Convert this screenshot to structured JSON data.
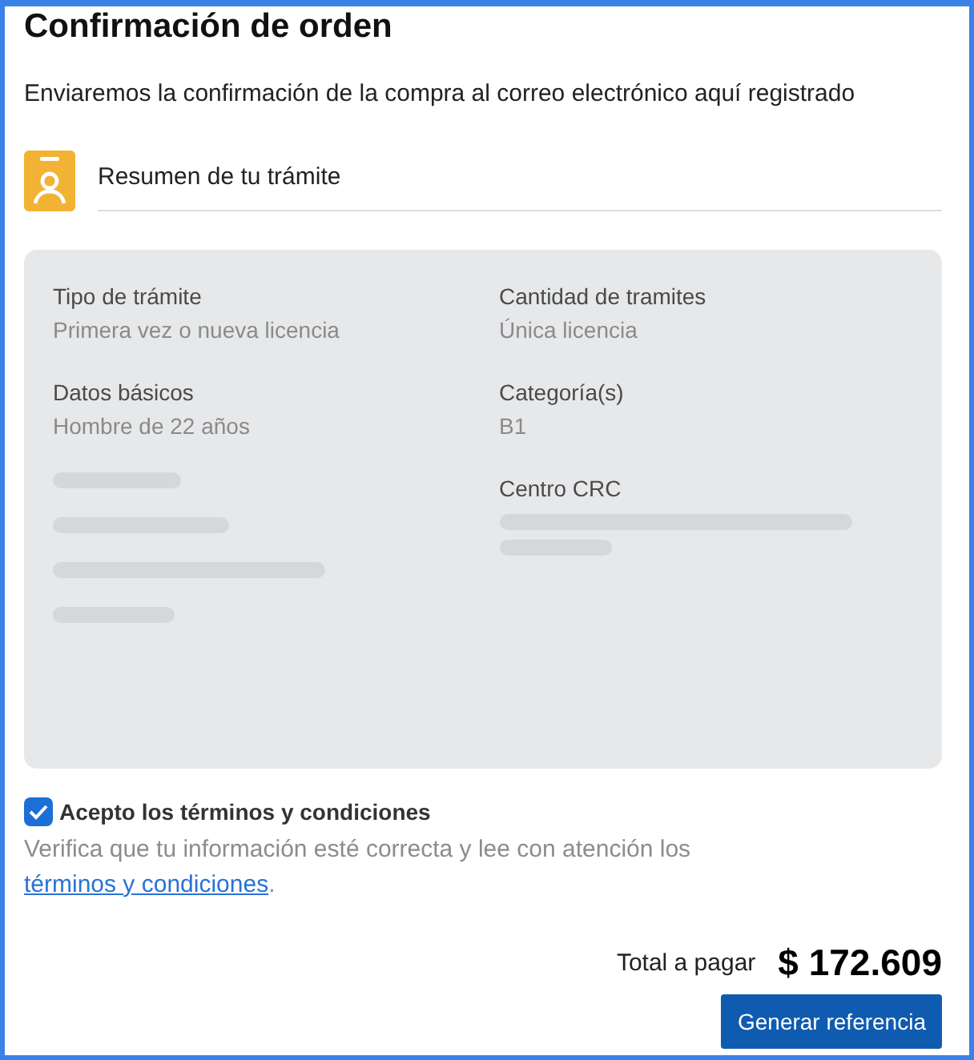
{
  "title": "Confirmación de orden",
  "subtitle": "Enviaremos la confirmación de la compra al correo electrónico aquí registrado",
  "section": {
    "title": "Resumen de tu trámite"
  },
  "summary": {
    "left": [
      {
        "kind": "field",
        "label": "Tipo de trámite",
        "value": "Primera vez o nueva licencia"
      },
      {
        "kind": "field",
        "label": "Datos básicos",
        "value": "Hombre de 22 años"
      },
      {
        "kind": "redacted"
      },
      {
        "kind": "redacted"
      },
      {
        "kind": "redacted"
      },
      {
        "kind": "redacted"
      }
    ],
    "right": [
      {
        "kind": "field",
        "label": "Cantidad de tramites",
        "value": "Única licencia"
      },
      {
        "kind": "field",
        "label": "Categoría(s)",
        "value": "B1"
      },
      {
        "kind": "label",
        "label": "Centro CRC"
      },
      {
        "kind": "redacted"
      },
      {
        "kind": "redacted"
      }
    ]
  },
  "terms": {
    "label": "Acepto los términos y condiciones",
    "checked": true,
    "note": "Verifica que tu información esté correcta y lee con atención los",
    "link": "términos y condiciones",
    "after": "."
  },
  "total": {
    "label": "Total a pagar",
    "amount": "$ 172.609"
  },
  "button": "Generar referencia"
}
